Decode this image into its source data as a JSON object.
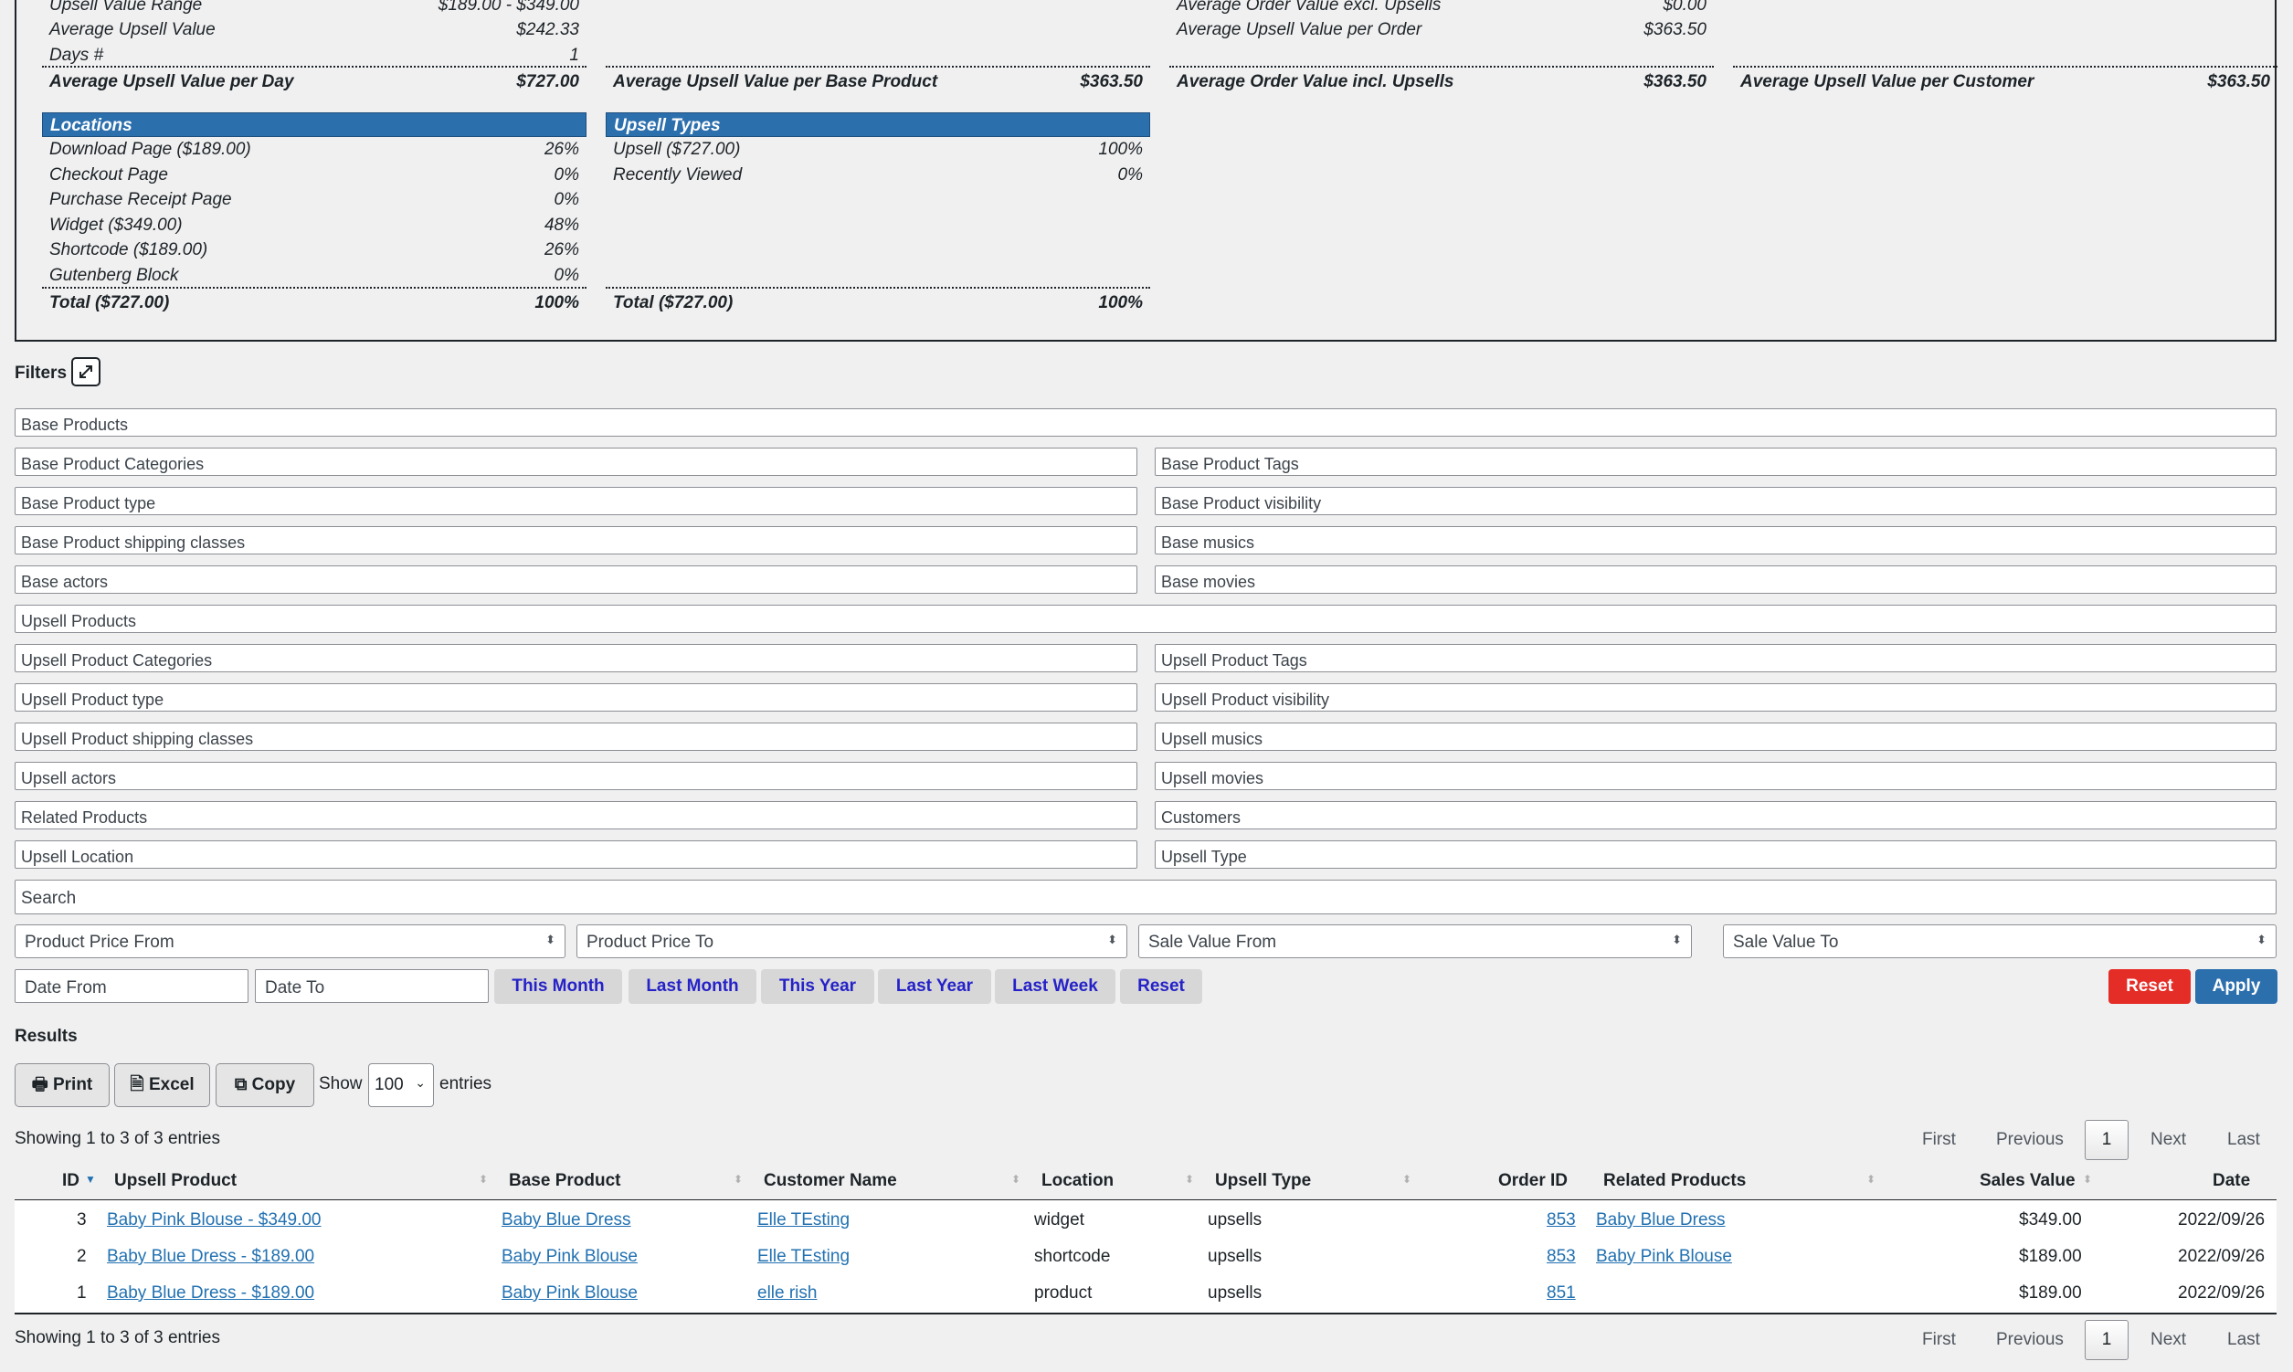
{
  "summary": {
    "col1_top": [
      {
        "label": "Upsell Value Range",
        "value": "$189.00 - $349.00"
      },
      {
        "label": "Average Upsell Value",
        "value": "$242.33"
      },
      {
        "label": "Days #",
        "value": "1"
      }
    ],
    "col1_total": {
      "label": "Average Upsell Value per Day",
      "value": "$727.00"
    },
    "col2_total": {
      "label": "Average Upsell Value per Base Product",
      "value": "$363.50"
    },
    "col3_top": [
      {
        "label": "Average Order Value excl. Upsells",
        "value": "$0.00"
      },
      {
        "label": "Average Upsell Value per Order",
        "value": "$363.50"
      }
    ],
    "col3_total": {
      "label": "Average Order Value incl. Upsells",
      "value": "$363.50"
    },
    "col4_total": {
      "label": "Average Upsell Value per Customer",
      "value": "$363.50"
    },
    "locations": {
      "title": "Locations",
      "rows": [
        {
          "label": "Download Page  ($189.00)",
          "value": "26%"
        },
        {
          "label": "Checkout Page",
          "value": "0%"
        },
        {
          "label": "Purchase Receipt Page",
          "value": "0%"
        },
        {
          "label": "Widget  ($349.00)",
          "value": "48%"
        },
        {
          "label": "Shortcode  ($189.00)",
          "value": "26%"
        },
        {
          "label": "Gutenberg Block",
          "value": "0%"
        }
      ],
      "total": {
        "label": "Total  ($727.00)",
        "value": "100%"
      }
    },
    "upsell_types": {
      "title": "Upsell Types",
      "rows": [
        {
          "label": "Upsell  ($727.00)",
          "value": "100%"
        },
        {
          "label": "Recently Viewed",
          "value": "0%"
        }
      ],
      "total": {
        "label": "Total  ($727.00)",
        "value": "100%"
      }
    }
  },
  "filters": {
    "title": "Filters",
    "base_products": "Base Products",
    "base_product_categories": "Base Product Categories",
    "base_product_tags": "Base Product Tags",
    "base_product_type": "Base Product type",
    "base_product_visibility": "Base Product visibility",
    "base_product_shipping": "Base Product shipping classes",
    "base_musics": "Base musics",
    "base_actors": "Base actors",
    "base_movies": "Base movies",
    "upsell_products": "Upsell Products",
    "upsell_product_categories": "Upsell Product Categories",
    "upsell_product_tags": "Upsell Product Tags",
    "upsell_product_type": "Upsell Product type",
    "upsell_product_visibility": "Upsell Product visibility",
    "upsell_product_shipping": "Upsell Product shipping classes",
    "upsell_musics": "Upsell musics",
    "upsell_actors": "Upsell actors",
    "upsell_movies": "Upsell movies",
    "related_products": "Related Products",
    "customers": "Customers",
    "upsell_location": "Upsell Location",
    "upsell_type": "Upsell Type",
    "search_placeholder": "Search",
    "product_price_from": "Product Price From",
    "product_price_to": "Product Price To",
    "sale_value_from": "Sale Value From",
    "sale_value_to": "Sale Value To",
    "date_from": "Date From",
    "date_to": "Date To",
    "this_month": "This Month",
    "last_month": "Last Month",
    "this_year": "This Year",
    "last_year": "Last Year",
    "last_week": "Last Week",
    "reset_quick": "Reset",
    "reset": "Reset",
    "apply": "Apply"
  },
  "results": {
    "title": "Results",
    "print": "Print",
    "excel": "Excel",
    "copy": "Copy",
    "show": "Show",
    "entries_value": "100",
    "entries": "entries",
    "showing": "Showing 1 to 3 of 3 entries",
    "pager": {
      "first": "First",
      "previous": "Previous",
      "current": "1",
      "next": "Next",
      "last": "Last"
    },
    "columns": [
      "ID",
      "Upsell Product",
      "Base Product",
      "Customer Name",
      "Location",
      "Upsell Type",
      "Order ID",
      "Related Products",
      "Sales Value",
      "Date"
    ],
    "rows": [
      {
        "id": "3",
        "upsell_product": "Baby Pink Blouse - $349.00",
        "base_product": "Baby Blue Dress",
        "customer": "Elle TEsting",
        "location": "widget",
        "type": "upsells",
        "order_id": "853",
        "related": "Baby Blue Dress",
        "sales_value": "$349.00",
        "date": "2022/09/26"
      },
      {
        "id": "2",
        "upsell_product": "Baby Blue Dress - $189.00",
        "base_product": "Baby Pink Blouse",
        "customer": "Elle TEsting",
        "location": "shortcode",
        "type": "upsells",
        "order_id": "853",
        "related": "Baby Pink Blouse",
        "sales_value": "$189.00",
        "date": "2022/09/26"
      },
      {
        "id": "1",
        "upsell_product": "Baby Blue Dress - $189.00",
        "base_product": "Baby Pink Blouse",
        "customer": "elle rish",
        "location": "product",
        "type": "upsells",
        "order_id": "851",
        "related": "",
        "sales_value": "$189.00",
        "date": "2022/09/26"
      }
    ]
  }
}
